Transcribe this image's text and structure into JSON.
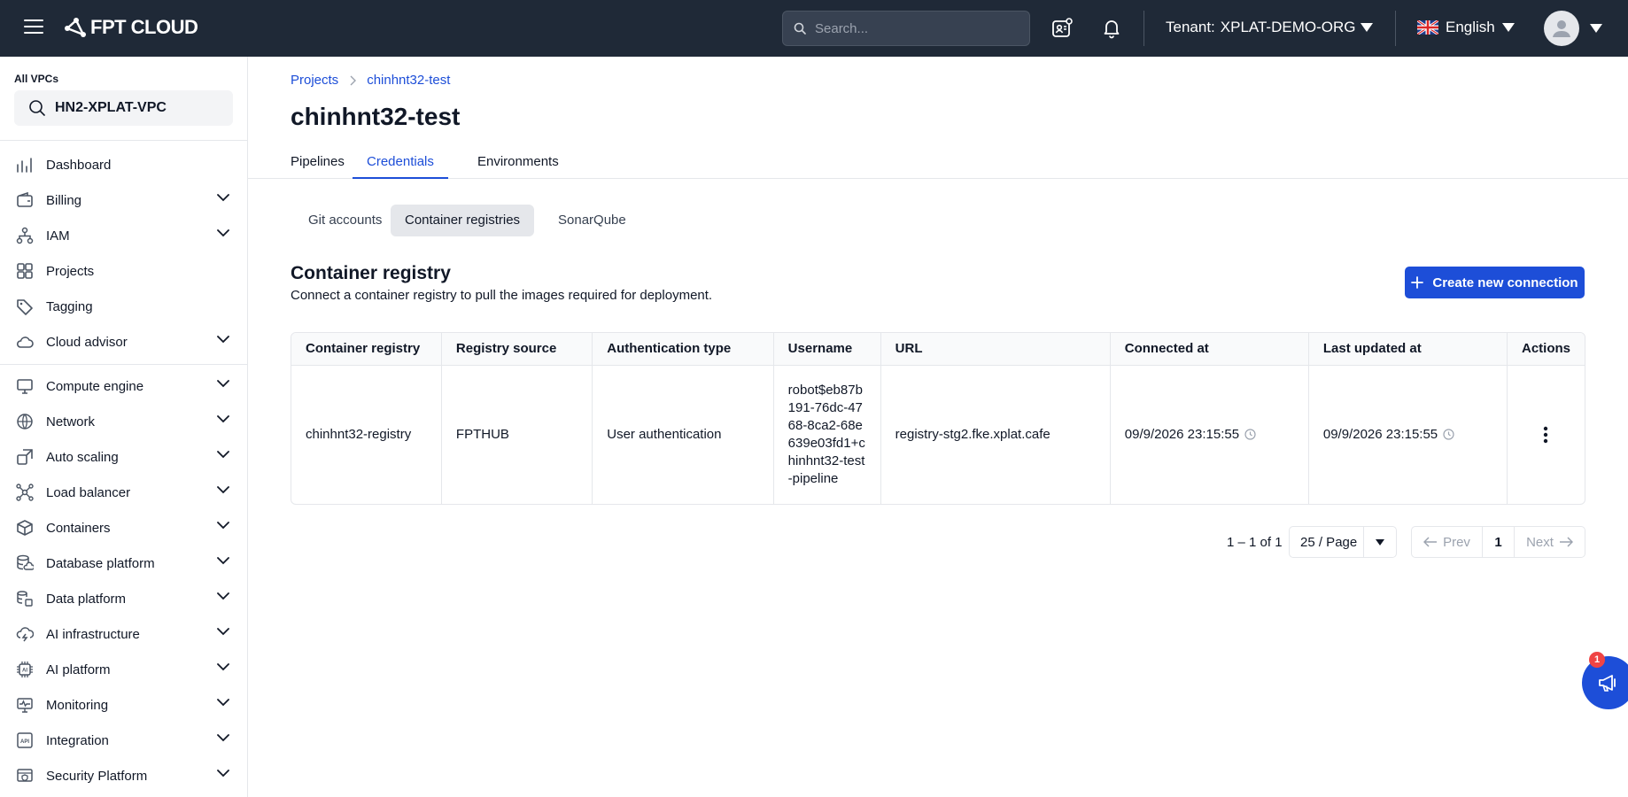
{
  "header": {
    "logo": "FPT CLOUD",
    "search_placeholder": "Search...",
    "tenant_label": "Tenant:",
    "tenant_value": "XPLAT-DEMO-ORG",
    "language": "English"
  },
  "sidebar": {
    "vpc_label": "All VPCs",
    "vpc_value": "HN2-XPLAT-VPC",
    "items": [
      {
        "label": "Dashboard",
        "icon": "dashboard-icon"
      },
      {
        "label": "Billing",
        "icon": "wallet-icon"
      },
      {
        "label": "IAM",
        "icon": "iam-icon"
      },
      {
        "label": "Projects",
        "icon": "grid-icon"
      },
      {
        "label": "Tagging",
        "icon": "tag-icon"
      },
      {
        "label": "Cloud advisor",
        "icon": "cloud-icon"
      },
      {
        "label": "Compute engine",
        "icon": "monitor-icon"
      },
      {
        "label": "Network",
        "icon": "globe-icon"
      },
      {
        "label": "Auto scaling",
        "icon": "scale-icon"
      },
      {
        "label": "Load balancer",
        "icon": "network-icon"
      },
      {
        "label": "Containers",
        "icon": "box-icon"
      },
      {
        "label": "Database platform",
        "icon": "database-icon"
      },
      {
        "label": "Data platform",
        "icon": "data-icon"
      },
      {
        "label": "AI infrastructure",
        "icon": "cloud-bolt-icon"
      },
      {
        "label": "AI platform",
        "icon": "chip-icon"
      },
      {
        "label": "Monitoring",
        "icon": "monitoring-icon"
      },
      {
        "label": "Integration",
        "icon": "api-icon"
      },
      {
        "label": "Security Platform",
        "icon": "shield-icon"
      }
    ]
  },
  "breadcrumb": [
    "Projects",
    "chinhnt32-test"
  ],
  "page_title": "chinhnt32-test",
  "tabs": [
    "Pipelines",
    "Credentials",
    "Environments"
  ],
  "active_tab": "Credentials",
  "subtabs": [
    "Git accounts",
    "Container registries",
    "SonarQube"
  ],
  "active_subtab": "Container registries",
  "section": {
    "title": "Container registry",
    "description": "Connect a container registry to pull the images required for deployment.",
    "create_button": "Create new connection"
  },
  "table": {
    "columns": [
      "Container registry",
      "Registry source",
      "Authentication type",
      "Username",
      "URL",
      "Connected at",
      "Last updated at",
      "Actions"
    ],
    "rows": [
      {
        "registry": "chinhnt32-registry",
        "source": "FPTHUB",
        "auth": "User authentication",
        "username": "robot$eb87b191-76dc-4768-8ca2-68e639e03fd1+chinhnt32-test-pipeline",
        "url": "registry-stg2.fke.xplat.cafe",
        "connected_at": "09/9/2026 23:15:55",
        "updated_at": "09/9/2026 23:15:55"
      }
    ]
  },
  "pagination": {
    "range": "1 – 1 of 1",
    "page_size": "25 / Page",
    "prev": "Prev",
    "page": "1",
    "next": "Next"
  },
  "fab_badge": "1",
  "colors": {
    "topbar": "#1f2937",
    "accent": "#1d4ed8",
    "badge": "#ef4444"
  }
}
